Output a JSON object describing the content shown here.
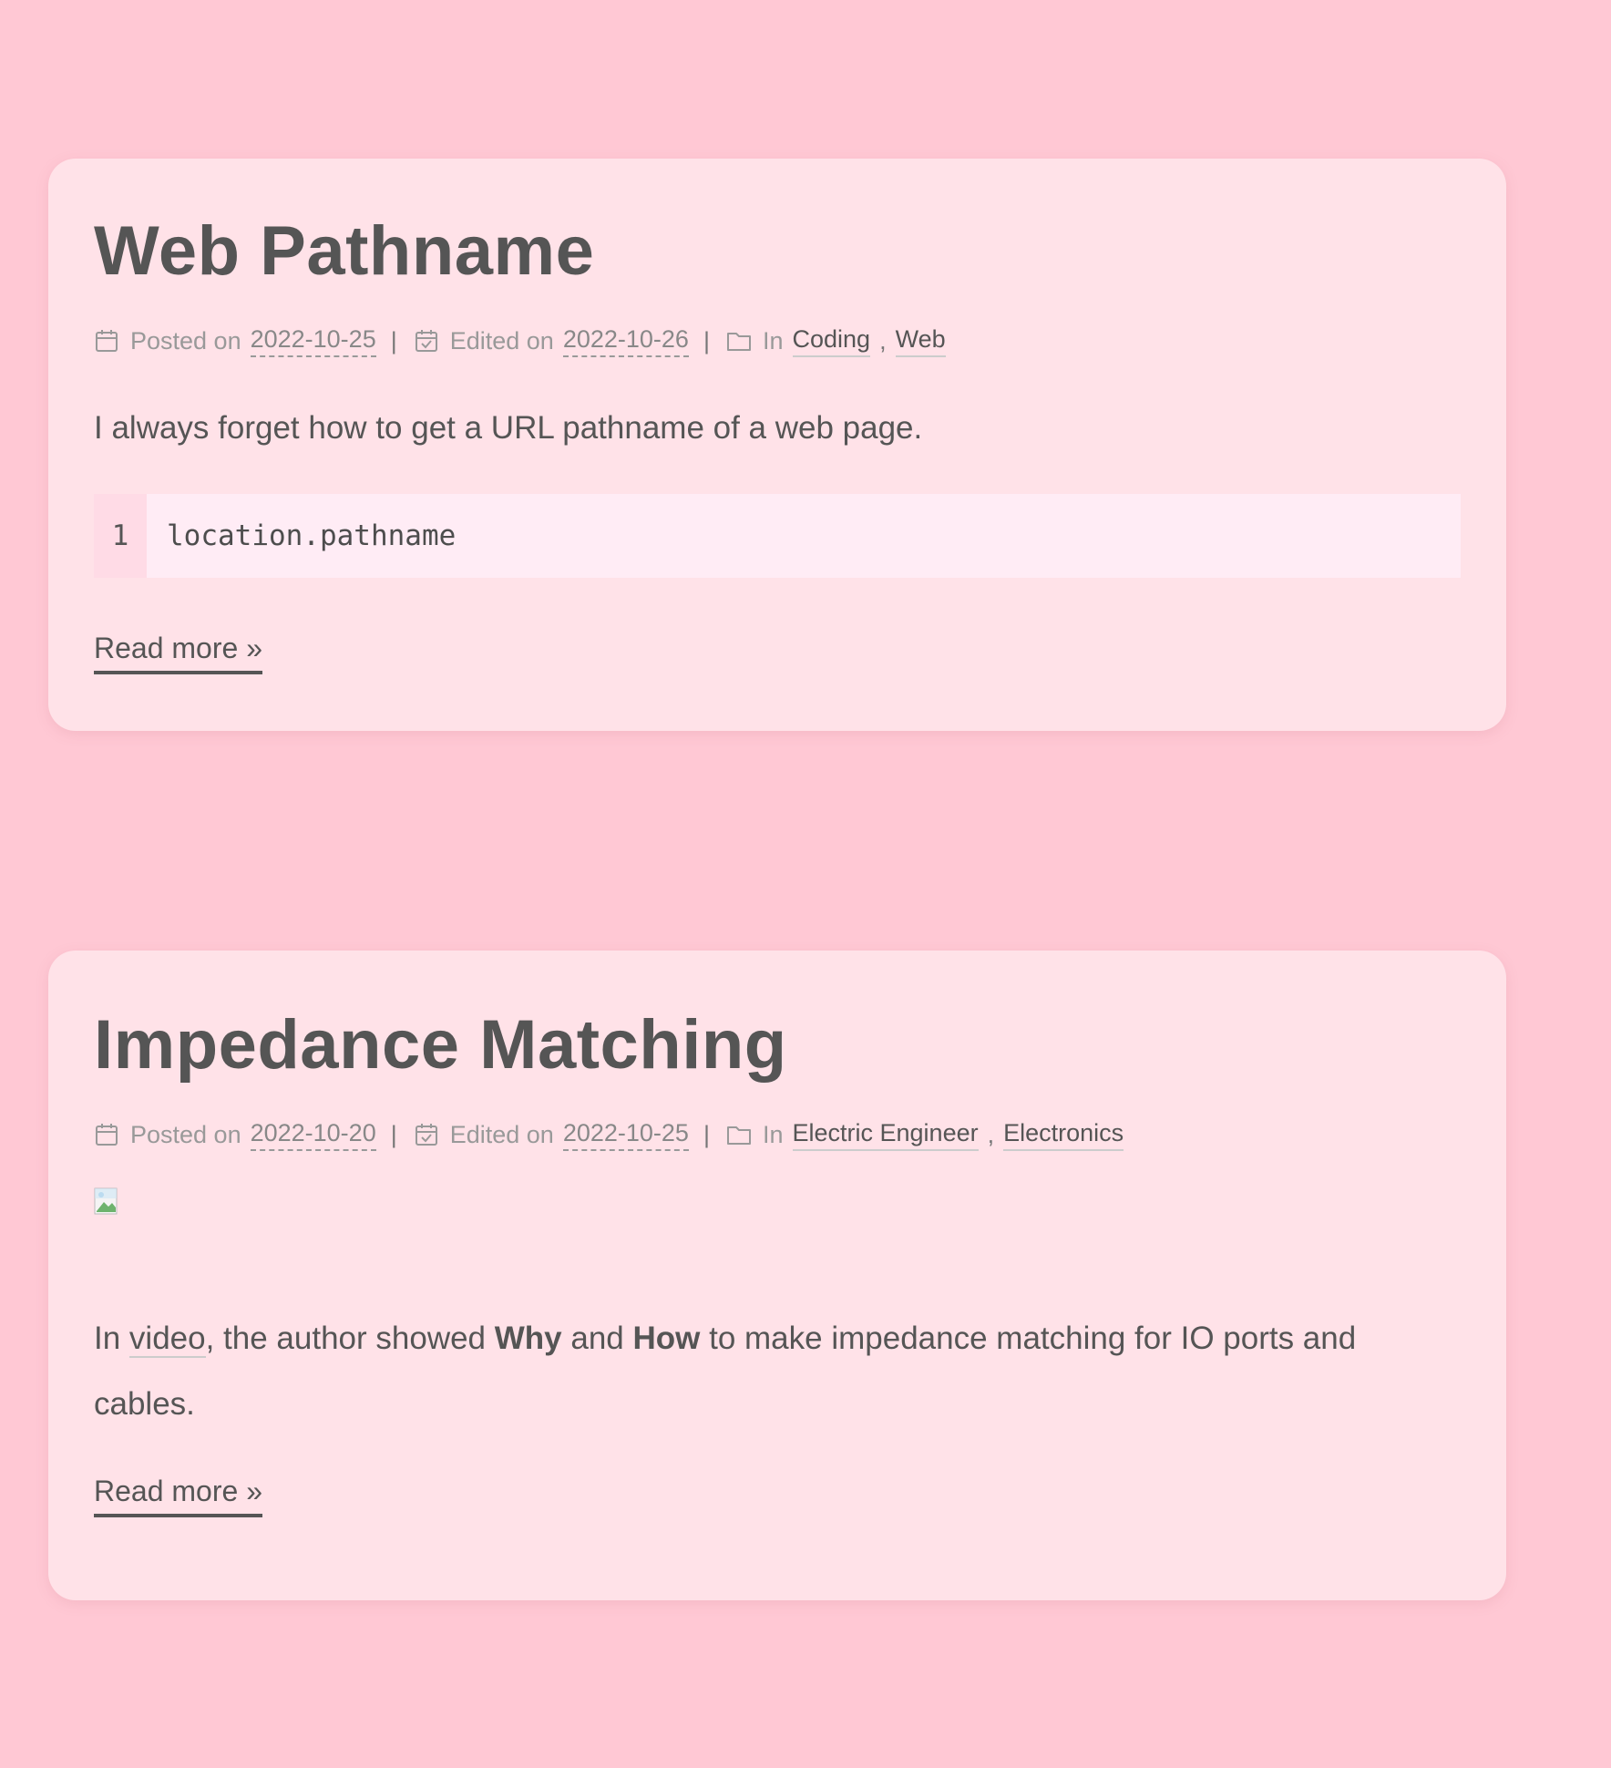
{
  "posts": [
    {
      "title": "Web Pathname",
      "meta": {
        "posted_label": "Posted on",
        "posted_date": "2022-10-25",
        "edited_label": "Edited on",
        "edited_date": "2022-10-26",
        "in_label": "In",
        "categories": [
          "Coding",
          "Web"
        ],
        "separator": "|",
        "comma": ","
      },
      "excerpt": "I always forget how to get a URL pathname of a web page.",
      "code": {
        "line_number": "1",
        "line": "location.pathname"
      },
      "read_more": "Read more »"
    },
    {
      "title": "Impedance Matching",
      "meta": {
        "posted_label": "Posted on",
        "posted_date": "2022-10-20",
        "edited_label": "Edited on",
        "edited_date": "2022-10-25",
        "in_label": "In",
        "categories": [
          "Electric Engineer",
          "Electronics"
        ],
        "separator": "|",
        "comma": ","
      },
      "excerpt": {
        "part1": "In ",
        "link": "video",
        "part2": ", the author showed ",
        "bold1": "Why",
        "part3": " and ",
        "bold2": "How",
        "part4": " to make impedance matching for IO ports and cables."
      },
      "read_more": "Read more »"
    }
  ],
  "icons": {
    "posted": "calendar-icon",
    "edited": "calendar-check-icon",
    "category": "folder-icon",
    "broken_image": "broken-image-icon"
  },
  "colors": {
    "background": "#ffc8d4",
    "card": "#ffe2e8",
    "text": "#555555",
    "meta": "#999999",
    "code_bg": "#ffecf5",
    "gutter_bg": "#ffdbe6"
  }
}
